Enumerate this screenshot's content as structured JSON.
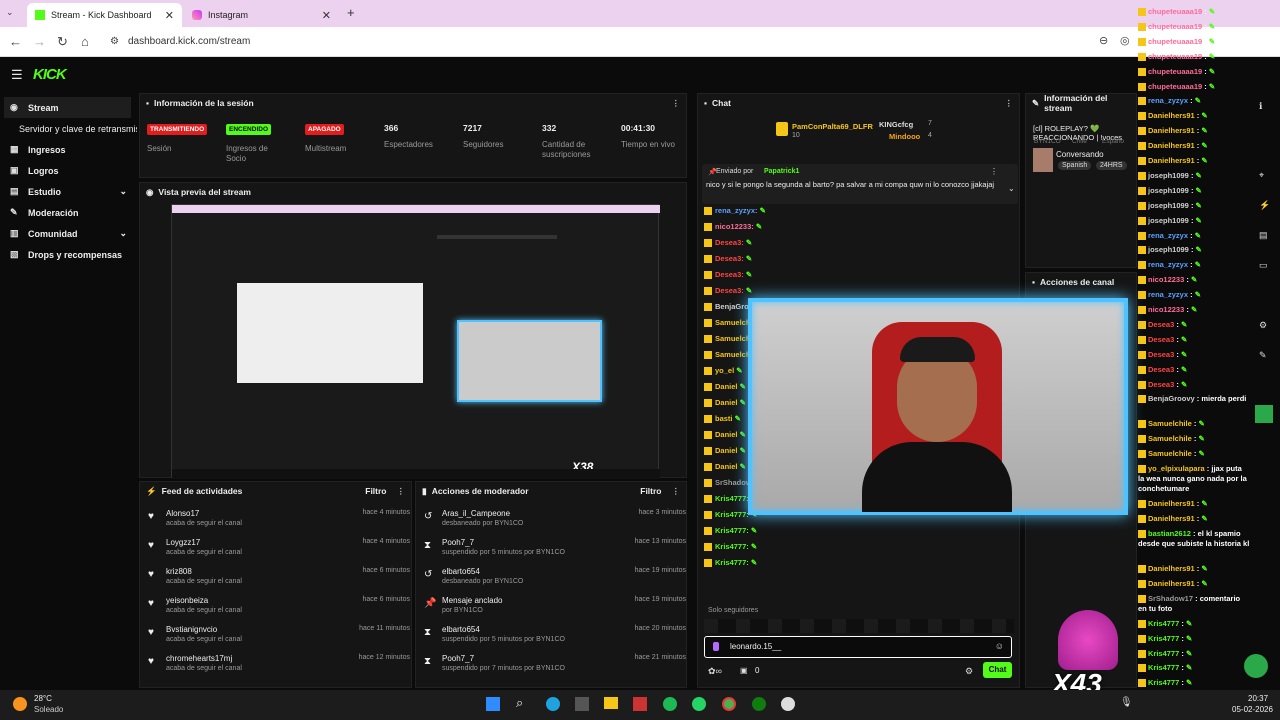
{
  "browser": {
    "tabs": [
      {
        "title": "Stream - Kick Dashboard"
      },
      {
        "title": "Instagram"
      }
    ],
    "url": "dashboard.kick.com/stream"
  },
  "app": {
    "logo": "KICK"
  },
  "sidebar": {
    "items": [
      {
        "label": "Stream"
      },
      {
        "label": "Servidor y clave de retransmisión"
      },
      {
        "label": "Ingresos"
      },
      {
        "label": "Logros"
      },
      {
        "label": "Estudio"
      },
      {
        "label": "Moderación"
      },
      {
        "label": "Comunidad"
      },
      {
        "label": "Drops y recompensas"
      }
    ]
  },
  "session": {
    "title": "Información de la sesión",
    "badges": [
      {
        "text": "TRANSMITIENDO",
        "color": "#e11d1d",
        "label": "Sesión"
      },
      {
        "text": "ENCENDIDO",
        "color": "#53fc18",
        "label": "Ingresos de Socio"
      },
      {
        "text": "APAGADO",
        "color": "#e11d1d",
        "label": "Multistream"
      }
    ],
    "stats": [
      {
        "value": "366",
        "label": "Espectadores"
      },
      {
        "value": "7217",
        "label": "Seguidores"
      },
      {
        "value": "332",
        "label": "Cantidad de suscripciones"
      },
      {
        "value": "00:41:30",
        "label": "Tiempo en vivo"
      }
    ]
  },
  "preview": {
    "title": "Vista previa del stream"
  },
  "feed": {
    "title": "Feed de actividades",
    "filter": "Filtro",
    "rows": [
      {
        "name": "Alonso17",
        "sub": "acaba de seguir el canal",
        "time": "hace 4 minutos"
      },
      {
        "name": "Loygzz17",
        "sub": "acaba de seguir el canal",
        "time": "hace 4 minutos"
      },
      {
        "name": "kriz808",
        "sub": "acaba de seguir el canal",
        "time": "hace 6 minutos"
      },
      {
        "name": "yeisonbeiza",
        "sub": "acaba de seguir el canal",
        "time": "hace 6 minutos"
      },
      {
        "name": "Bvstianignvcio",
        "sub": "acaba de seguir el canal",
        "time": "hace 11 minutos"
      },
      {
        "name": "chromehearts17mj",
        "sub": "acaba de seguir el canal",
        "time": "hace 12 minutos"
      }
    ]
  },
  "modactions": {
    "title": "Acciones de moderador",
    "filter": "Filtro",
    "rows": [
      {
        "name": "Aras_il_Campeone",
        "sub": "desbaneado por BYN1CO",
        "time": "hace 3 minutos",
        "icon": "↺"
      },
      {
        "name": "Pooh7_7",
        "sub": "suspendido por 5 minutos por BYN1CO",
        "time": "hace 13 minutos",
        "icon": "⧗"
      },
      {
        "name": "elbarto654",
        "sub": "desbaneado por BYN1CO",
        "time": "hace 19 minutos",
        "icon": "↺"
      },
      {
        "name": "Mensaje anclado",
        "sub": "por BYN1CO",
        "time": "hace 19 minutos",
        "icon": "📌"
      },
      {
        "name": "elbarto654",
        "sub": "suspendido por 5 minutos por BYN1CO",
        "time": "hace 20 minutos",
        "icon": "⧗"
      },
      {
        "name": "Pooh7_7",
        "sub": "suspendido por 7 minutos por BYN1CO",
        "time": "hace 21 minutos",
        "icon": "⧗"
      }
    ]
  },
  "chat": {
    "title": "Chat",
    "top_gifters": [
      {
        "name": "PamConPalta69_DLFR",
        "count": "10"
      },
      {
        "name": "KINGcfcg",
        "count": "7"
      },
      {
        "name": "Mindooo",
        "count": "4"
      }
    ],
    "pinned_by": "Enviado por",
    "pinned_user": "Papatrick1",
    "pinned_text": "nico y si le pongo la segunda al barto? pa salvar a mi compa quw ni lo conozco jjakajaj",
    "lines": [
      {
        "user": "rena_zyzyx:",
        "color": "#5aa0ff"
      },
      {
        "user": "nico12233:",
        "color": "#ff6b9a"
      },
      {
        "user": "Desea3:",
        "color": "#ff4444"
      },
      {
        "user": "Desea3:",
        "color": "#ff4444"
      },
      {
        "user": "Desea3:",
        "color": "#ff4444"
      },
      {
        "user": "Desea3:",
        "color": "#ff4444"
      },
      {
        "user": "BenjaGroov",
        "color": "#cfcfcf"
      },
      {
        "user": "Samuelch",
        "color": "#f5c518"
      },
      {
        "user": "Samuelch",
        "color": "#f5c518"
      },
      {
        "user": "Samuelch",
        "color": "#f5c518"
      },
      {
        "user": "yo_el",
        "color": "#f5c518"
      },
      {
        "user": "Daniel",
        "color": "#f5c518"
      },
      {
        "user": "Daniel",
        "color": "#f5c518"
      },
      {
        "user": "basti",
        "color": "#f5c518"
      },
      {
        "user": "Daniel",
        "color": "#f5c518"
      },
      {
        "user": "Daniel",
        "color": "#f5c518"
      },
      {
        "user": "Daniel",
        "color": "#f5c518"
      },
      {
        "user": "SrShadow17",
        "color": "#9a9a9a"
      },
      {
        "user": "Kris4777:",
        "color": "#53fc18"
      },
      {
        "user": "Kris4777:",
        "color": "#53fc18"
      },
      {
        "user": "Kris4777:",
        "color": "#53fc18"
      },
      {
        "user": "Kris4777:",
        "color": "#53fc18"
      },
      {
        "user": "Kris4777:",
        "color": "#53fc18"
      }
    ],
    "followers_only": "Solo seguidores",
    "input_value": "leonardo.15__",
    "count": "0",
    "send_label": "Chat"
  },
  "streaminfo": {
    "title": "Información del stream",
    "stream_title": "[cl] ROLEPLAY? 💚 REACCIONANDO | !voces",
    "category": "Conversando",
    "tags": [
      "Spanish",
      "24HRS"
    ],
    "partial_tags": [
      "BYN1CO",
      "Chile",
      "Españo"
    ]
  },
  "channelactions": {
    "title": "Acciones de canal"
  },
  "overlay": {
    "multiplier_left": "X38",
    "multiplier_right": "X43"
  },
  "right_chat": [
    {
      "user": "chupeteuaaa19",
      "text": "",
      "color": "#ff6b9a"
    },
    {
      "user": "chupeteuaaa19",
      "text": "",
      "color": "#ff6b9a"
    },
    {
      "user": "chupeteuaaa19",
      "text": "",
      "color": "#ff6b9a"
    },
    {
      "user": "chupeteuaaa19",
      "text": "",
      "color": "#ff6b9a"
    },
    {
      "user": "chupeteuaaa19",
      "text": "",
      "color": "#ff6b9a"
    },
    {
      "user": "chupeteuaaa19",
      "text": "",
      "color": "#ff6b9a"
    },
    {
      "user": "rena_zyzyx",
      "text": "",
      "color": "#5aa0ff"
    },
    {
      "user": "Danielhers91",
      "text": "",
      "color": "#f5c518"
    },
    {
      "user": "Danielhers91",
      "text": "",
      "color": "#f5c518"
    },
    {
      "user": "Danielhers91",
      "text": "",
      "color": "#f5c518"
    },
    {
      "user": "Danielhers91",
      "text": "",
      "color": "#f5c518"
    },
    {
      "user": "joseph1099",
      "text": "",
      "color": "#cfcfcf"
    },
    {
      "user": "joseph1099",
      "text": "",
      "color": "#cfcfcf"
    },
    {
      "user": "joseph1099",
      "text": "",
      "color": "#cfcfcf"
    },
    {
      "user": "joseph1099",
      "text": "",
      "color": "#cfcfcf"
    },
    {
      "user": "rena_zyzyx",
      "text": "",
      "color": "#5aa0ff"
    },
    {
      "user": "joseph1099",
      "text": "",
      "color": "#cfcfcf"
    },
    {
      "user": "rena_zyzyx",
      "text": "",
      "color": "#5aa0ff"
    },
    {
      "user": "nico12233",
      "text": "",
      "color": "#ff6b9a"
    },
    {
      "user": "rena_zyzyx",
      "text": "",
      "color": "#5aa0ff"
    },
    {
      "user": "nico12233",
      "text": "",
      "color": "#ff6b9a"
    },
    {
      "user": "Desea3",
      "text": "",
      "color": "#ff4444"
    },
    {
      "user": "Desea3",
      "text": "",
      "color": "#ff4444"
    },
    {
      "user": "Desea3",
      "text": "",
      "color": "#ff4444"
    },
    {
      "user": "Desea3",
      "text": "",
      "color": "#ff4444"
    },
    {
      "user": "Desea3",
      "text": "",
      "color": "#ff4444"
    },
    {
      "user": "BenjaGroovy",
      "text": "mierda perdi",
      "color": "#cfcfcf"
    },
    {
      "user": "Samuelchile",
      "text": "",
      "color": "#f5c518"
    },
    {
      "user": "Samuelchile",
      "text": "",
      "color": "#f5c518"
    },
    {
      "user": "Samuelchile",
      "text": "",
      "color": "#f5c518"
    },
    {
      "user": "yo_elpixulapara",
      "text": "jjax puta la wea nunca gano nada por la conchetumare",
      "color": "#f5c518"
    },
    {
      "user": "Danielhers91",
      "text": "",
      "color": "#f5c518"
    },
    {
      "user": "Danielhers91",
      "text": "",
      "color": "#f5c518"
    },
    {
      "user": "bastian2612",
      "text": "el kl spamio desde que subiste la historia kl",
      "color": "#53fc18"
    },
    {
      "user": "Danielhers91",
      "text": "",
      "color": "#f5c518"
    },
    {
      "user": "Danielhers91",
      "text": "",
      "color": "#f5c518"
    },
    {
      "user": "SrShadow17",
      "text": "comentario en tu foto",
      "color": "#9a9a9a"
    },
    {
      "user": "Kris4777",
      "text": "",
      "color": "#53fc18"
    },
    {
      "user": "Kris4777",
      "text": "",
      "color": "#53fc18"
    },
    {
      "user": "Kris4777",
      "text": "",
      "color": "#53fc18"
    },
    {
      "user": "Kris4777",
      "text": "",
      "color": "#53fc18"
    },
    {
      "user": "Kris4777",
      "text": "",
      "color": "#53fc18"
    }
  ],
  "taskbar": {
    "weather_temp": "28°C",
    "weather_desc": "Soleado",
    "time": "20:37",
    "date": "05-02-2026"
  }
}
